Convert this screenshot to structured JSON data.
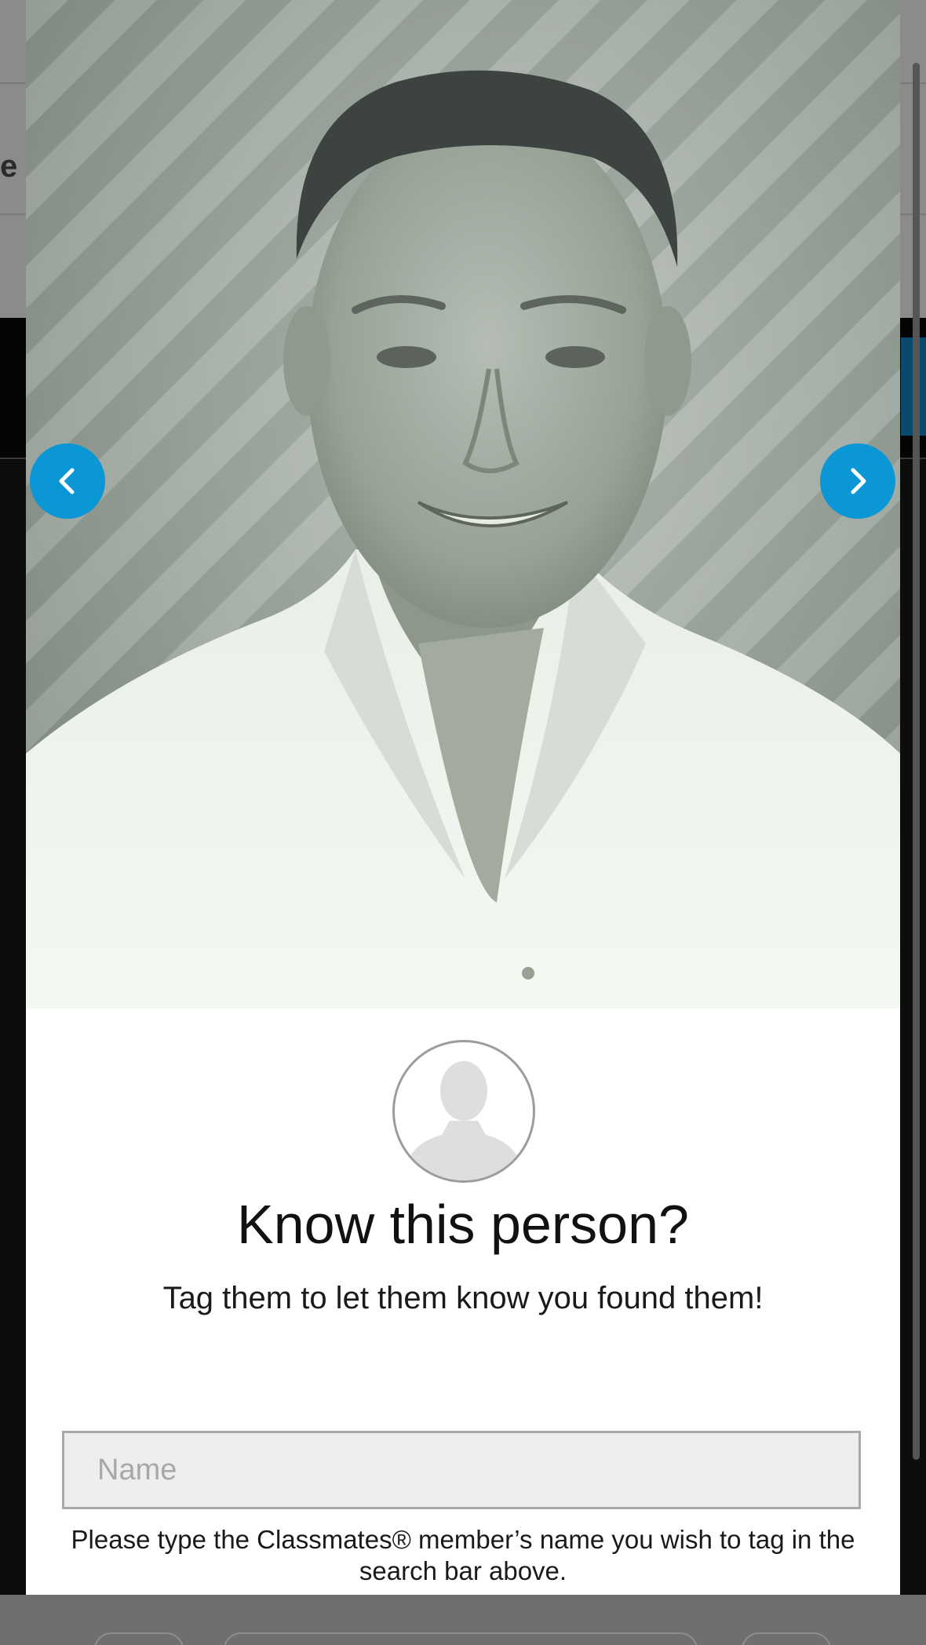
{
  "background_page": {
    "heading_fragment": "e"
  },
  "photo_viewer": {
    "prev_icon": "chevron-left-icon",
    "next_icon": "chevron-right-icon",
    "accent_color": "#0b97d6"
  },
  "tag_panel": {
    "avatar_icon": "person-silhouette-icon",
    "title": "Know this person?",
    "subtitle": "Tag them to let them know you found them!",
    "name_input": {
      "value": "",
      "placeholder": "Name"
    },
    "helper_text": "Please type the Classmates® member’s name you wish to tag in the search bar above."
  }
}
